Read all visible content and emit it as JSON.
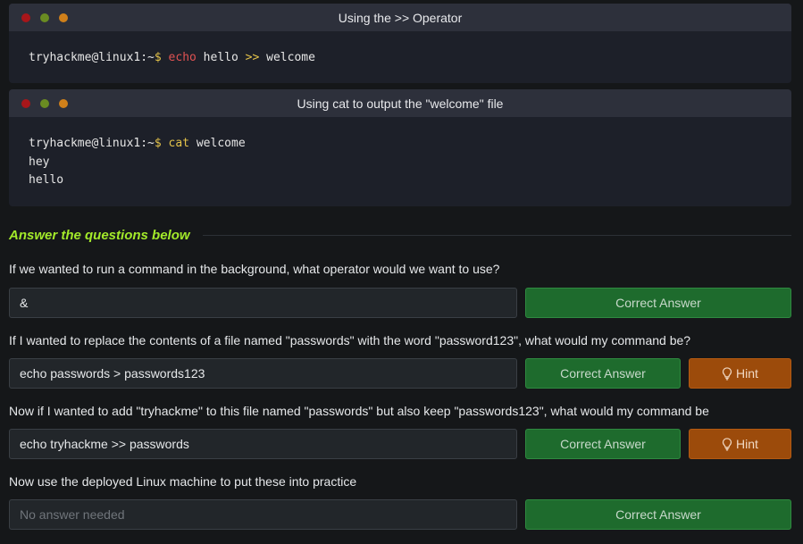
{
  "terminals": [
    {
      "title": "Using the >> Operator",
      "prompt": "tryhackme@linux1:~",
      "dollar": "$",
      "command_keyword": "echo",
      "command_rest_1": " hello ",
      "command_operator": ">>",
      "command_rest_2": " welcome"
    },
    {
      "title": "Using cat to output the \"welcome\" file",
      "prompt": "tryhackme@linux1:~",
      "dollar": "$",
      "command_keyword": "cat",
      "command_rest": " welcome",
      "output": [
        "hey",
        "hello"
      ]
    }
  ],
  "section": {
    "title": "Answer the questions below"
  },
  "questions": [
    {
      "text": "If we wanted to run a command in the background, what operator would we want to use?",
      "answer": "&",
      "button": "Correct Answer"
    },
    {
      "text": "If I wanted to replace the contents of a file named \"passwords\" with the word \"password123\", what would my command be?",
      "answer": "echo passwords > passwords123",
      "button": "Correct Answer",
      "hint": "Hint"
    },
    {
      "text": "Now if I wanted to add \"tryhackme\" to this file named \"passwords\" but also keep \"passwords123\", what would my command be",
      "answer": "echo tryhackme >> passwords",
      "button": "Correct Answer",
      "hint": "Hint"
    },
    {
      "text": "Now use the deployed Linux machine to put these into practice",
      "placeholder": "No answer needed",
      "button": "Correct Answer"
    }
  ],
  "colors": {
    "accent": "#a3ea2a",
    "correct_button": "#1e6b2d",
    "hint_button": "#9c4b0b",
    "terminal_bg": "#1d2029",
    "page_bg": "#151719"
  },
  "icons": {
    "hint": "lightbulb-icon",
    "window_controls": [
      "close-dot-icon",
      "minimize-dot-icon",
      "maximize-dot-icon"
    ]
  }
}
